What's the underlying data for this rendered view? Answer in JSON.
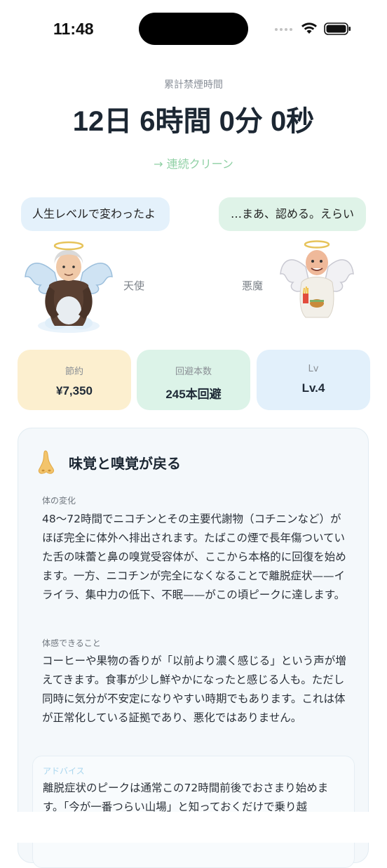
{
  "status_bar": {
    "time": "11:48"
  },
  "header": {
    "total_label": "累計禁煙時間",
    "elapsed": "12日 6時間 0分 0秒",
    "streak_link": "→ 連続クリーン"
  },
  "characters": {
    "angel": {
      "speech": "人生レベルで変わったよ",
      "label": "天使"
    },
    "devil": {
      "speech": "…まあ、認める。えらい",
      "label": "悪魔"
    }
  },
  "stats": {
    "savings": {
      "label": "節約",
      "value": "¥7,350"
    },
    "avoided": {
      "label": "回避本数",
      "value": "245本回避"
    },
    "level": {
      "label": "Lv",
      "value": "Lv.4"
    }
  },
  "milestone": {
    "icon": "nose-icon",
    "title": "味覚と嗅覚が戻る",
    "body_label": "体の変化",
    "body_text": "48〜72時間でニコチンとその主要代謝物（コチニンなど）がほぼ完全に体外へ排出されます。たばこの煙で長年傷ついていた舌の味蕾と鼻の嗅覚受容体が、ここから本格的に回復を始めます。一方、ニコチンが完全になくなることで離脱症状——イライラ、集中力の低下、不眠——がこの頃ピークに達します。",
    "feel_label": "体感できること",
    "feel_text": "コーヒーや果物の香りが「以前より濃く感じる」という声が増えてきます。食事が少し鮮やかになったと感じる人も。ただし同時に気分が不安定になりやすい時期でもあります。これは体が正常化している証拠であり、悪化ではありません。",
    "advice_label": "アドバイス",
    "advice_text": "離脱症状のピークは通常この72時間前後でおさまり始めます。「今が一番つらい山場」と知っておくだけで乗り越"
  },
  "colors": {
    "savings_bg": "#fcefcf",
    "avoided_bg": "#dcf3e8",
    "level_bg": "#e2f0fb",
    "accent_green": "#8fd0a4"
  }
}
